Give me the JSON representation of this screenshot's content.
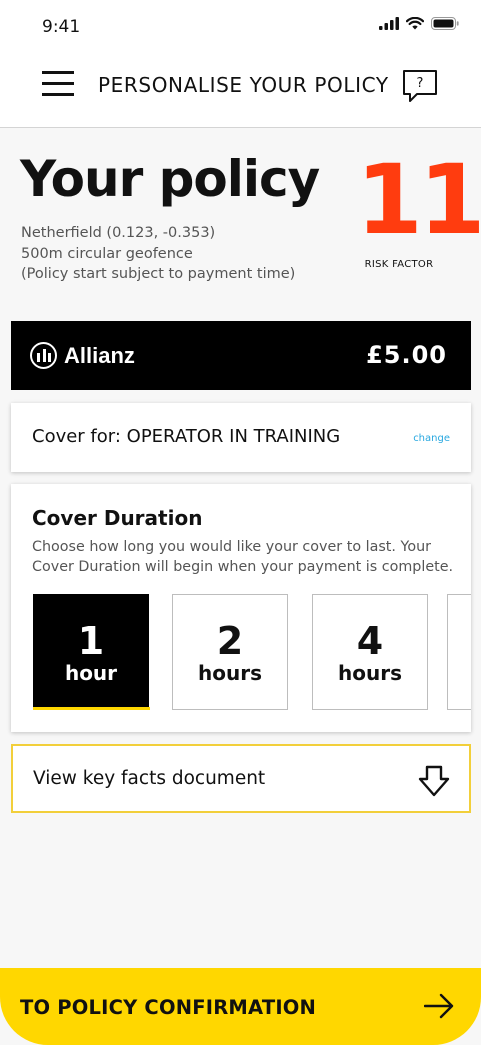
{
  "status": {
    "time": "9:41"
  },
  "header": {
    "title": "PERSONALISE YOUR POLICY",
    "help_icon_text": "?"
  },
  "policy": {
    "title": "Your policy",
    "location": "Netherfield (0.123, -0.353)",
    "geofence": "500m circular geofence",
    "note": "(Policy start subject to payment time)",
    "risk_value": "11",
    "risk_label": "RISK FACTOR"
  },
  "insurer": {
    "name": "Allianz",
    "price": "£5.00"
  },
  "cover": {
    "text": "Cover for: OPERATOR IN TRAINING",
    "change_label": "change"
  },
  "duration": {
    "title": "Cover Duration",
    "description": "Choose how long you would like your cover to last. Your Cover Duration will begin when your payment is complete.",
    "options": [
      {
        "num": "1",
        "unit": "hour",
        "selected": true
      },
      {
        "num": "2",
        "unit": "hours",
        "selected": false
      },
      {
        "num": "4",
        "unit": "hours",
        "selected": false
      }
    ]
  },
  "keyfacts": {
    "label": "View key facts document"
  },
  "cta": {
    "label": "TO POLICY CONFIRMATION"
  },
  "colors": {
    "accent": "#ffd700",
    "risk": "#ff3c0f",
    "link": "#29a8e0"
  }
}
